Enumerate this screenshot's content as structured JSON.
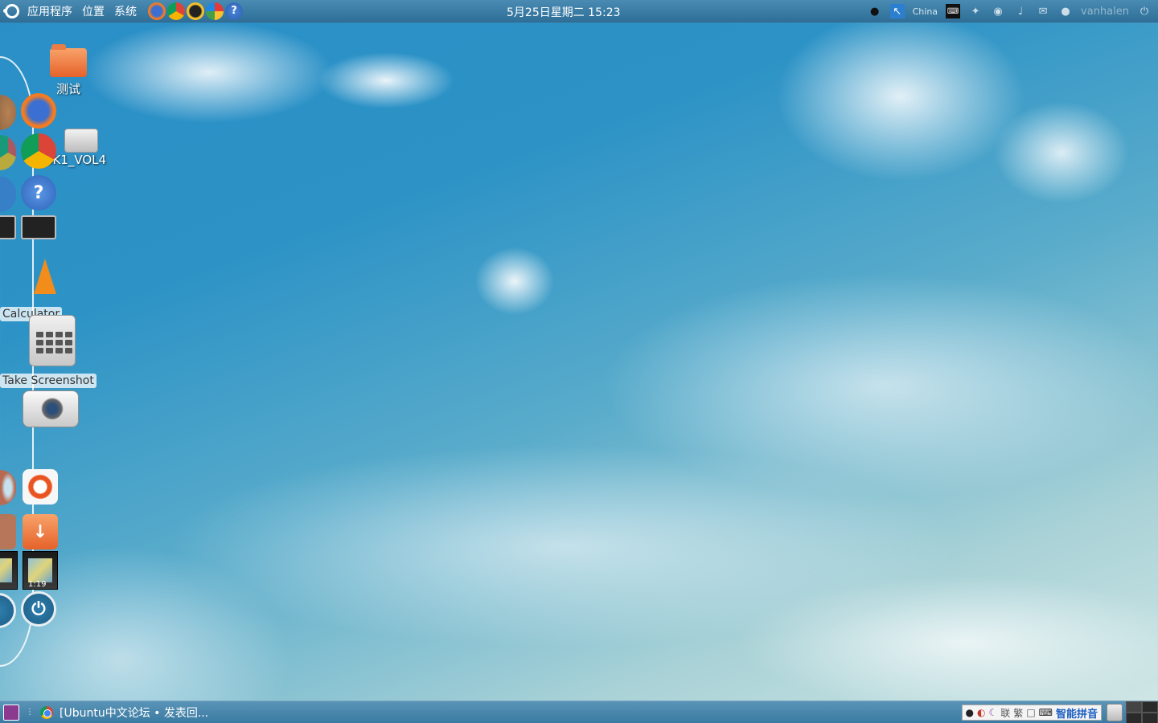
{
  "top_panel": {
    "menus": [
      "应用程序",
      "位置",
      "系统"
    ],
    "clock": "5月25日星期二 15:23",
    "tray_text": "China",
    "username": "vanhalen",
    "launcher_icons": [
      "firefox-icon",
      "chrome-icon",
      "qq-icon",
      "picasa-icon",
      "help-icon"
    ],
    "tray_icons": [
      "qq-tray-icon",
      "network-tray-icon",
      "keyboard-tray-icon",
      "plug-tray-icon",
      "wireless-tray-icon",
      "volume-icon",
      "mail-icon",
      "chat-icon",
      "power-icon"
    ]
  },
  "desktop": {
    "folder_label": "测试",
    "disk_label": "DISK1_VOL4"
  },
  "dock": {
    "calculator_label": "Calculator",
    "screenshot_label": "Take Screenshot",
    "photo_caption": "1:19",
    "items": [
      "firefox",
      "chrome",
      "help",
      "terminal",
      "vlc",
      "calculator",
      "screenshot",
      "ubuntu",
      "downloads",
      "photo",
      "power"
    ]
  },
  "bottom_panel": {
    "task_title": "[Ubuntu中文论坛 • 发表回...",
    "ime_labels": [
      "联",
      "繁",
      "智能拼音"
    ]
  },
  "colors": {
    "panel": "#3a7aa2",
    "sky": "#2d93c6"
  }
}
